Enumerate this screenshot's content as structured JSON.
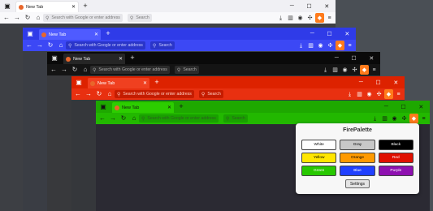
{
  "browser": {
    "tab_title": "New Tab",
    "url_placeholder": "Search with Google or enter address",
    "search_placeholder": "Search"
  },
  "windows": [
    {
      "theme": "gray",
      "accent": "#f0f0f4"
    },
    {
      "theme": "blue",
      "accent": "#3a45f0"
    },
    {
      "theme": "black",
      "accent": "#0a0a0a"
    },
    {
      "theme": "red",
      "accent": "#dd2200"
    },
    {
      "theme": "green",
      "accent": "#1ea800"
    }
  ],
  "popup": {
    "title": "FirePalette",
    "buttons": [
      {
        "label": "White",
        "color": "#ffffff",
        "text": "#000000"
      },
      {
        "label": "Gray",
        "color": "#c8c8c8",
        "text": "#000000"
      },
      {
        "label": "Black",
        "color": "#000000",
        "text": "#ffffff"
      },
      {
        "label": "Yellow",
        "color": "#ffe600",
        "text": "#000000"
      },
      {
        "label": "Orange",
        "color": "#ff9a00",
        "text": "#000000"
      },
      {
        "label": "Red",
        "color": "#e01000",
        "text": "#ffffff"
      },
      {
        "label": "Green",
        "color": "#28c800",
        "text": "#ffffff"
      },
      {
        "label": "Blue",
        "color": "#2040ff",
        "text": "#ffffff"
      },
      {
        "label": "Purple",
        "color": "#8e10b0",
        "text": "#ffffff"
      }
    ],
    "settings_label": "Settings"
  },
  "icons": [
    "tabs-icon",
    "back-icon",
    "forward-icon",
    "reload-icon",
    "home-icon",
    "search-icon",
    "download-icon",
    "library-icon",
    "account-icon",
    "extension-icon",
    "firepalette-icon",
    "menu-icon",
    "minimize-icon",
    "maximize-icon",
    "close-icon"
  ]
}
